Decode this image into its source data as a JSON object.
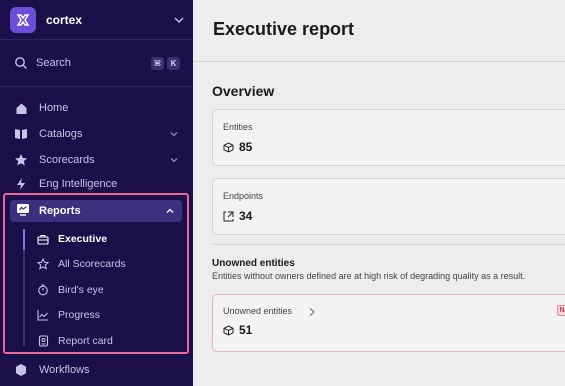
{
  "workspace": {
    "name": "cortex"
  },
  "search": {
    "label": "Search",
    "shortcut": [
      "⌘",
      "K"
    ]
  },
  "nav": {
    "home": "Home",
    "catalogs": "Catalogs",
    "scorecards": "Scorecards",
    "eng_intelligence": "Eng Intelligence",
    "reports": "Reports",
    "workflows": "Workflows"
  },
  "reports_menu": [
    {
      "label": "Executive",
      "active": true
    },
    {
      "label": "All Scorecards"
    },
    {
      "label": "Bird's eye"
    },
    {
      "label": "Progress"
    },
    {
      "label": "Report card"
    }
  ],
  "main": {
    "title": "Executive report",
    "overview_title": "Overview",
    "cards": [
      {
        "label": "Entities",
        "value": "85"
      },
      {
        "label": "Endpoints",
        "value": "34"
      }
    ],
    "unowned": {
      "title": "Unowned entities",
      "description": "Entities without owners defined are at high risk of degrading quality as a result.",
      "card_label": "Unowned entities",
      "card_value": "51",
      "badge": "N"
    }
  },
  "colors": {
    "sidebar_bg": "#1b0f4a",
    "active_bg": "#3c2f80",
    "highlight_border": "#e8679a",
    "accent": "#6b4fd6"
  }
}
